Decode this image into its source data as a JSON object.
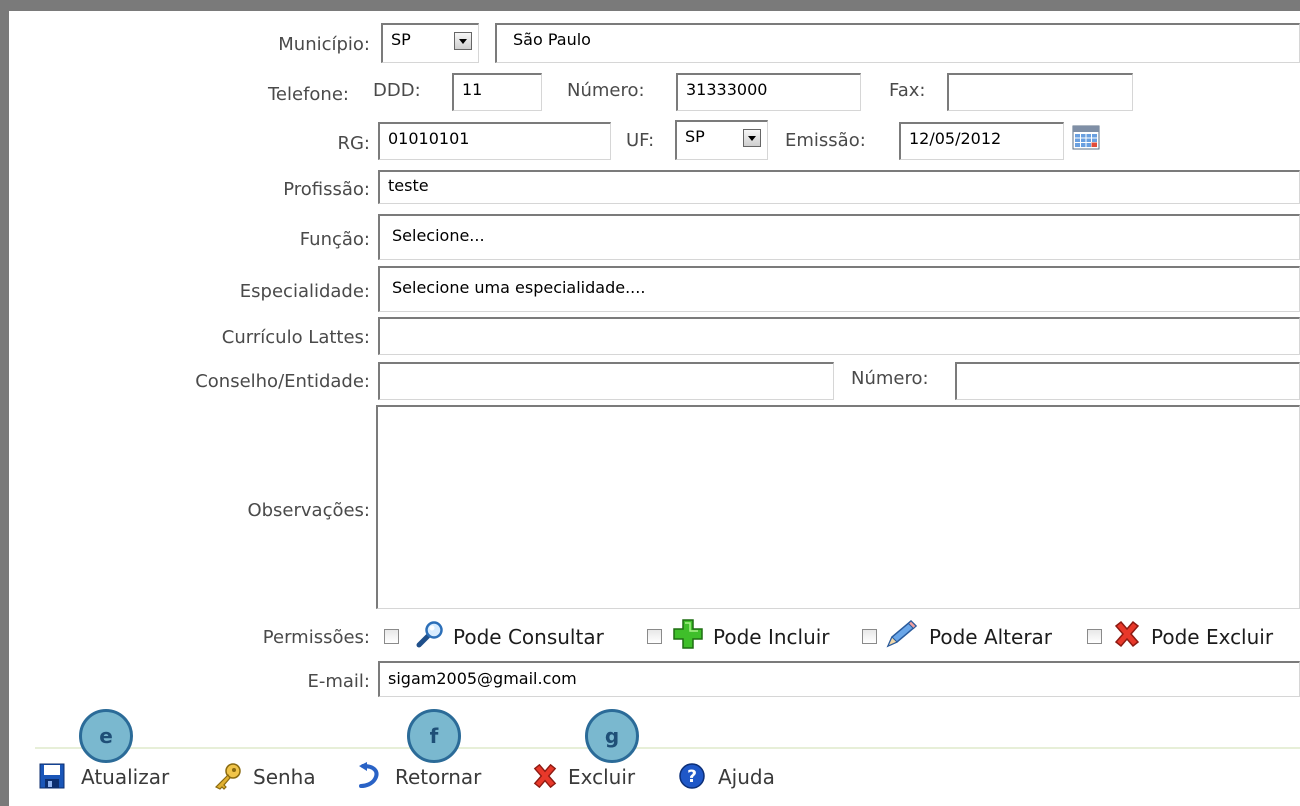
{
  "form": {
    "municipio": {
      "label": "Município:",
      "uf": "SP",
      "cidade": "São Paulo"
    },
    "telefone": {
      "label": "Telefone:",
      "ddd_label": "DDD:",
      "ddd": "11",
      "numero_label": "Número:",
      "numero": "31333000",
      "fax_label": "Fax:",
      "fax": ""
    },
    "rg": {
      "label": "RG:",
      "value": "01010101",
      "uf_label": "UF:",
      "uf": "SP",
      "emissao_label": "Emissão:",
      "emissao": "12/05/2012"
    },
    "profissao": {
      "label": "Profissão:",
      "value": "teste"
    },
    "funcao": {
      "label": "Função:",
      "value": "Selecione..."
    },
    "especialidade": {
      "label": "Especialidade:",
      "value": "Selecione uma especialidade...."
    },
    "curriculo": {
      "label": "Currículo Lattes:",
      "value": ""
    },
    "conselho": {
      "label": "Conselho/Entidade:",
      "value": "",
      "numero_label": "Número:",
      "numero": ""
    },
    "observacoes": {
      "label": "Observações:",
      "value": ""
    },
    "permissoes": {
      "label": "Permissões:",
      "items": [
        {
          "label": "Pode Consultar",
          "icon": "magnifier-icon",
          "checked": false
        },
        {
          "label": "Pode Incluir",
          "icon": "green-plus-icon",
          "checked": false
        },
        {
          "label": "Pode Alterar",
          "icon": "pencil-icon",
          "checked": false
        },
        {
          "label": "Pode Excluir",
          "icon": "red-x-icon",
          "checked": false
        }
      ]
    },
    "email": {
      "label": "E-mail:",
      "value": "sigam2005@gmail.com"
    }
  },
  "toolbar": {
    "atualizar": "Atualizar",
    "senha": "Senha",
    "retornar": "Retornar",
    "excluir": "Excluir",
    "ajuda": "Ajuda"
  },
  "annotations": {
    "e": "e",
    "f": "f",
    "g": "g"
  },
  "colors": {
    "frame": "#7a7a7a",
    "badge_fill": "#7ab8cf",
    "badge_border": "#2b6b98",
    "separator": "#e7efd8"
  }
}
